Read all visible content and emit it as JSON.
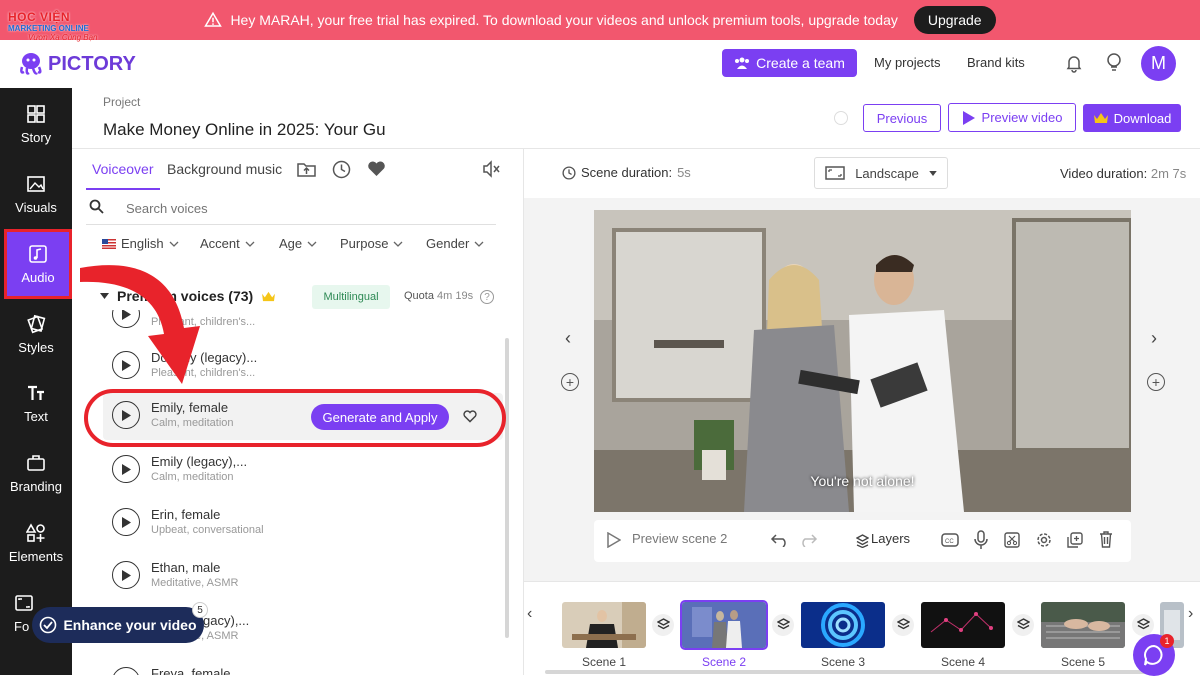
{
  "banner": {
    "message": "Hey MARAH, your free trial has expired. To download your videos and unlock premium tools, upgrade today",
    "upgrade_label": "Upgrade"
  },
  "watermark": {
    "line1": "HỌC VIỆN",
    "line2": "MARKETING ONLINE",
    "line3": "Vươn Xa Cùng Bạn"
  },
  "header": {
    "logo": "PICTORY",
    "create_team": "Create a team",
    "my_projects": "My projects",
    "brand_kits": "Brand kits",
    "avatar_letter": "M"
  },
  "sidebar": {
    "items": [
      {
        "label": "Story",
        "icon": "story-icon"
      },
      {
        "label": "Visuals",
        "icon": "image-icon"
      },
      {
        "label": "Audio",
        "icon": "music-icon"
      },
      {
        "label": "Styles",
        "icon": "styles-icon"
      },
      {
        "label": "Text",
        "icon": "text-icon"
      },
      {
        "label": "Branding",
        "icon": "briefcase-icon"
      },
      {
        "label": "Elements",
        "icon": "elements-icon"
      },
      {
        "label": "Fo",
        "icon": "format-icon"
      }
    ]
  },
  "project": {
    "label": "Project",
    "title": "Make Money Online in 2025: Your Gu",
    "previous": "Previous",
    "preview_video": "Preview video",
    "download": "Download"
  },
  "audio_panel": {
    "tabs": [
      "Voiceover",
      "Background music"
    ],
    "search_placeholder": "Search voices",
    "filters": [
      "English",
      "Accent",
      "Age",
      "Purpose",
      "Gender"
    ],
    "section_title": "Premium voices (73)",
    "multilingual": "Multilingual",
    "quota_label": "Quota",
    "quota_value": "4m 19s",
    "voices": [
      {
        "name": "",
        "desc": "Pleasant, children's..."
      },
      {
        "name": "Dorothy (legacy)...",
        "desc": "Pleasant, children's..."
      },
      {
        "name": "Emily, female",
        "desc": "Calm, meditation"
      },
      {
        "name": "Emily (legacy),...",
        "desc": "Calm, meditation"
      },
      {
        "name": "Erin, female",
        "desc": "Upbeat, conversational"
      },
      {
        "name": "Ethan, male",
        "desc": "Meditative, ASMR"
      },
      {
        "name": "Ethan (legacy),...",
        "desc": "Meditative, ASMR"
      },
      {
        "name": "Freya, female",
        "desc": ""
      }
    ],
    "generate_label": "Generate and Apply"
  },
  "enhance": {
    "label": "Enhance your video",
    "badge": "5"
  },
  "scene_bar": {
    "scene_duration_label": "Scene duration:",
    "scene_duration_value": "5s",
    "orientation": "Landscape",
    "video_duration_label": "Video duration:",
    "video_duration_value": "2m 7s"
  },
  "video": {
    "caption": "You're not alone!"
  },
  "toolbar": {
    "preview_scene": "Preview scene 2",
    "layers": "Layers"
  },
  "timeline": {
    "scenes": [
      "Scene 1",
      "Scene 2",
      "Scene 3",
      "Scene 4",
      "Scene 5"
    ],
    "selected_index": 1
  },
  "chat": {
    "badge": "1"
  },
  "colors": {
    "accent": "#7b3ff2",
    "banner": "#f2576e",
    "highlight_red": "#e8232b",
    "sidebar": "#1c1c1c"
  }
}
